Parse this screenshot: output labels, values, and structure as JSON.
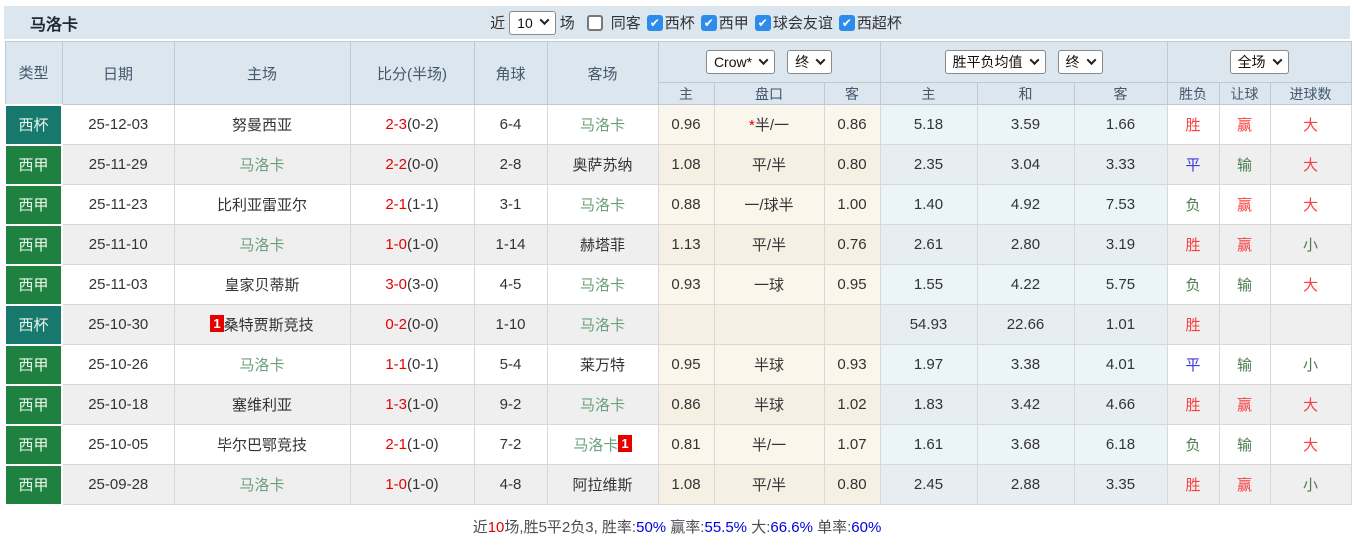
{
  "colors": {
    "cup_teal": "#17786e",
    "league_green": "#1f8140",
    "self_team_green": "#6aa07b",
    "score_red": "#e60000",
    "win_red": "#fa3e3e",
    "draw_blue": "#3a3add",
    "lose_green": "#4e7d52",
    "summary_blue": "#0000dd",
    "checkbox_blue": "#2b8ceb",
    "header_bg": "#dce6ef"
  },
  "title": "马洛卡",
  "topbar": {
    "recent_label": "近",
    "recent_value": "10",
    "games_label": "场",
    "checkboxes": [
      {
        "label": "同客",
        "checked": false
      },
      {
        "label": "西杯",
        "checked": true
      },
      {
        "label": "西甲",
        "checked": true
      },
      {
        "label": "球会友谊",
        "checked": true
      },
      {
        "label": "西超杯",
        "checked": true
      }
    ]
  },
  "header": {
    "type": "类型",
    "date": "日期",
    "home": "主场",
    "score": "比分(半场)",
    "corner": "角球",
    "away": "客场",
    "odds_source_select": "Crow*",
    "odds_time_select": "终",
    "avg_source_select": "胜平负均值",
    "avg_time_select": "终",
    "scope_select": "全场",
    "sub": {
      "odds_home": "主",
      "handicap": "盘口",
      "odds_away": "客",
      "avg_home": "主",
      "avg_draw": "和",
      "avg_away": "客",
      "result": "胜负",
      "handicap_result": "让球",
      "goals": "进球数"
    }
  },
  "rows": [
    {
      "type": "西杯",
      "date": "25-12-03",
      "home": "努曼西亚",
      "home_self": false,
      "home_badge": "",
      "score_ft": "2-3",
      "score_ht": "(0-2)",
      "corner": "6-4",
      "away": "马洛卡",
      "away_self": true,
      "away_badge": "",
      "odds_home": "0.96",
      "handicap_star": "*",
      "handicap": "半/一",
      "odds_away": "0.86",
      "avg_home": "5.18",
      "avg_draw": "3.59",
      "avg_away": "1.66",
      "result": "胜",
      "handicap_result": "赢",
      "goals": "大"
    },
    {
      "type": "西甲",
      "date": "25-11-29",
      "home": "马洛卡",
      "home_self": true,
      "home_badge": "",
      "score_ft": "2-2",
      "score_ht": "(0-0)",
      "corner": "2-8",
      "away": "奥萨苏纳",
      "away_self": false,
      "away_badge": "",
      "odds_home": "1.08",
      "handicap_star": "",
      "handicap": "平/半",
      "odds_away": "0.80",
      "avg_home": "2.35",
      "avg_draw": "3.04",
      "avg_away": "3.33",
      "result": "平",
      "handicap_result": "输",
      "goals": "大"
    },
    {
      "type": "西甲",
      "date": "25-11-23",
      "home": "比利亚雷亚尔",
      "home_self": false,
      "home_badge": "",
      "score_ft": "2-1",
      "score_ht": "(1-1)",
      "corner": "3-1",
      "away": "马洛卡",
      "away_self": true,
      "away_badge": "",
      "odds_home": "0.88",
      "handicap_star": "",
      "handicap": "一/球半",
      "odds_away": "1.00",
      "avg_home": "1.40",
      "avg_draw": "4.92",
      "avg_away": "7.53",
      "result": "负",
      "handicap_result": "赢",
      "goals": "大"
    },
    {
      "type": "西甲",
      "date": "25-11-10",
      "home": "马洛卡",
      "home_self": true,
      "home_badge": "",
      "score_ft": "1-0",
      "score_ht": "(1-0)",
      "corner": "1-14",
      "away": "赫塔菲",
      "away_self": false,
      "away_badge": "",
      "odds_home": "1.13",
      "handicap_star": "",
      "handicap": "平/半",
      "odds_away": "0.76",
      "avg_home": "2.61",
      "avg_draw": "2.80",
      "avg_away": "3.19",
      "result": "胜",
      "handicap_result": "赢",
      "goals": "小"
    },
    {
      "type": "西甲",
      "date": "25-11-03",
      "home": "皇家贝蒂斯",
      "home_self": false,
      "home_badge": "",
      "score_ft": "3-0",
      "score_ht": "(3-0)",
      "corner": "4-5",
      "away": "马洛卡",
      "away_self": true,
      "away_badge": "",
      "odds_home": "0.93",
      "handicap_star": "",
      "handicap": "一球",
      "odds_away": "0.95",
      "avg_home": "1.55",
      "avg_draw": "4.22",
      "avg_away": "5.75",
      "result": "负",
      "handicap_result": "输",
      "goals": "大"
    },
    {
      "type": "西杯",
      "date": "25-10-30",
      "home": "桑特贾斯竞技",
      "home_self": false,
      "home_badge": "1",
      "score_ft": "0-2",
      "score_ht": "(0-0)",
      "corner": "1-10",
      "away": "马洛卡",
      "away_self": true,
      "away_badge": "",
      "odds_home": "",
      "handicap_star": "",
      "handicap": "",
      "odds_away": "",
      "avg_home": "54.93",
      "avg_draw": "22.66",
      "avg_away": "1.01",
      "result": "胜",
      "handicap_result": "",
      "goals": ""
    },
    {
      "type": "西甲",
      "date": "25-10-26",
      "home": "马洛卡",
      "home_self": true,
      "home_badge": "",
      "score_ft": "1-1",
      "score_ht": "(0-1)",
      "corner": "5-4",
      "away": "莱万特",
      "away_self": false,
      "away_badge": "",
      "odds_home": "0.95",
      "handicap_star": "",
      "handicap": "半球",
      "odds_away": "0.93",
      "avg_home": "1.97",
      "avg_draw": "3.38",
      "avg_away": "4.01",
      "result": "平",
      "handicap_result": "输",
      "goals": "小"
    },
    {
      "type": "西甲",
      "date": "25-10-18",
      "home": "塞维利亚",
      "home_self": false,
      "home_badge": "",
      "score_ft": "1-3",
      "score_ht": "(1-0)",
      "corner": "9-2",
      "away": "马洛卡",
      "away_self": true,
      "away_badge": "",
      "odds_home": "0.86",
      "handicap_star": "",
      "handicap": "半球",
      "odds_away": "1.02",
      "avg_home": "1.83",
      "avg_draw": "3.42",
      "avg_away": "4.66",
      "result": "胜",
      "handicap_result": "赢",
      "goals": "大"
    },
    {
      "type": "西甲",
      "date": "25-10-05",
      "home": "毕尔巴鄂竞技",
      "home_self": false,
      "home_badge": "",
      "score_ft": "2-1",
      "score_ht": "(1-0)",
      "corner": "7-2",
      "away": "马洛卡",
      "away_self": true,
      "away_badge": "1",
      "odds_home": "0.81",
      "handicap_star": "",
      "handicap": "半/一",
      "odds_away": "1.07",
      "avg_home": "1.61",
      "avg_draw": "3.68",
      "avg_away": "6.18",
      "result": "负",
      "handicap_result": "输",
      "goals": "大"
    },
    {
      "type": "西甲",
      "date": "25-09-28",
      "home": "马洛卡",
      "home_self": true,
      "home_badge": "",
      "score_ft": "1-0",
      "score_ht": "(1-0)",
      "corner": "4-8",
      "away": "阿拉维斯",
      "away_self": false,
      "away_badge": "",
      "odds_home": "1.08",
      "handicap_star": "",
      "handicap": "平/半",
      "odds_away": "0.80",
      "avg_home": "2.45",
      "avg_draw": "2.88",
      "avg_away": "3.35",
      "result": "胜",
      "handicap_result": "赢",
      "goals": "小"
    }
  ],
  "summary": [
    {
      "text": "近",
      "color": "label"
    },
    {
      "text": "10",
      "color": "red"
    },
    {
      "text": "场,胜5平2负3, 胜率:",
      "color": "label"
    },
    {
      "text": "50%",
      "color": "blue"
    },
    {
      "text": " 赢率:",
      "color": "label"
    },
    {
      "text": "55.5%",
      "color": "blue"
    },
    {
      "text": " 大:",
      "color": "label"
    },
    {
      "text": "66.6%",
      "color": "blue"
    },
    {
      "text": " 单率:",
      "color": "label"
    },
    {
      "text": "60%",
      "color": "blue"
    }
  ]
}
